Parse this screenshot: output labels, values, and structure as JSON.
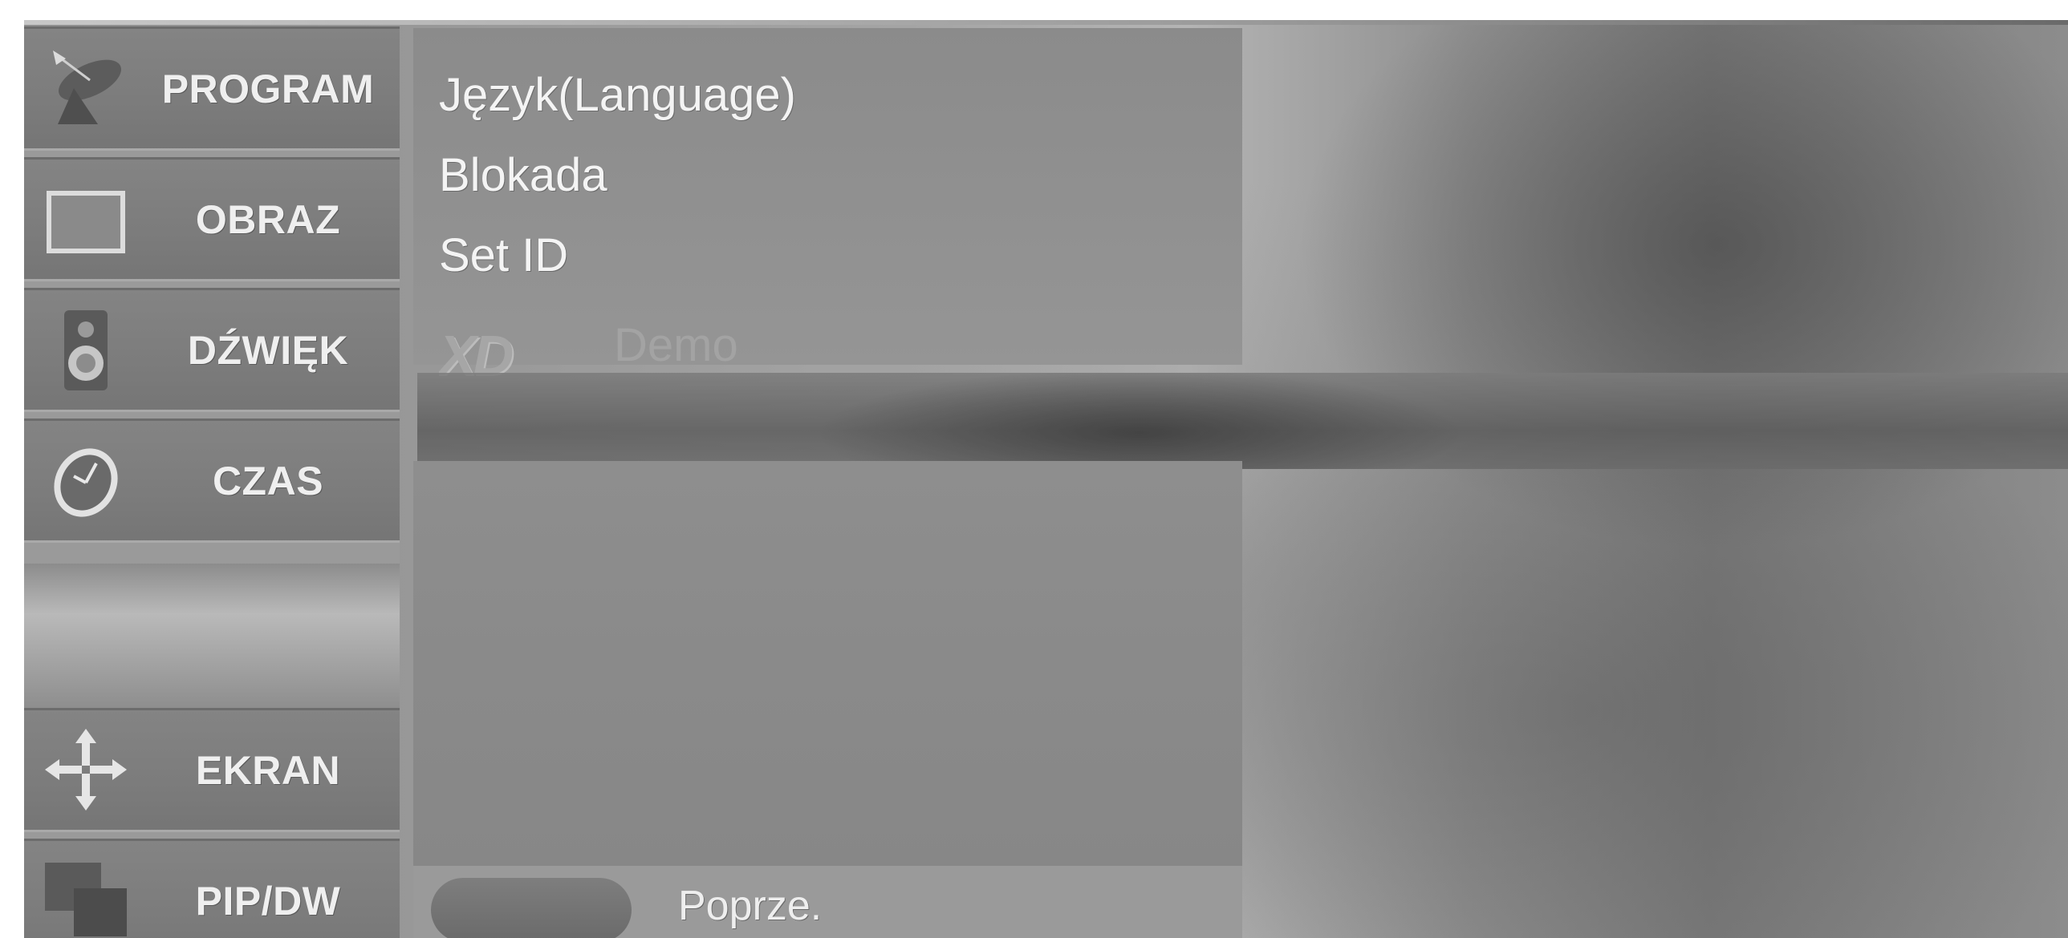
{
  "sidebar": {
    "items": [
      {
        "id": "program",
        "label": "PROGRAM",
        "icon": "satellite-dish-icon"
      },
      {
        "id": "obraz",
        "label": "OBRAZ",
        "icon": "tv-screen-icon"
      },
      {
        "id": "dzwiek",
        "label": "DŹWIĘK",
        "icon": "speaker-icon"
      },
      {
        "id": "czas",
        "label": "CZAS",
        "icon": "clock-icon"
      },
      {
        "id": "ekran",
        "label": "EKRAN",
        "icon": "move-arrows-icon"
      },
      {
        "id": "pipdw",
        "label": "PIP/DW",
        "icon": "picture-in-picture-icon"
      }
    ]
  },
  "menu": {
    "items": [
      {
        "label": "Język(Language)"
      },
      {
        "label": "Blokada"
      },
      {
        "label": "Set ID"
      }
    ],
    "xd_demo": {
      "logo": "XD",
      "label": "Demo"
    }
  },
  "footer": {
    "back_label": "Poprze."
  }
}
